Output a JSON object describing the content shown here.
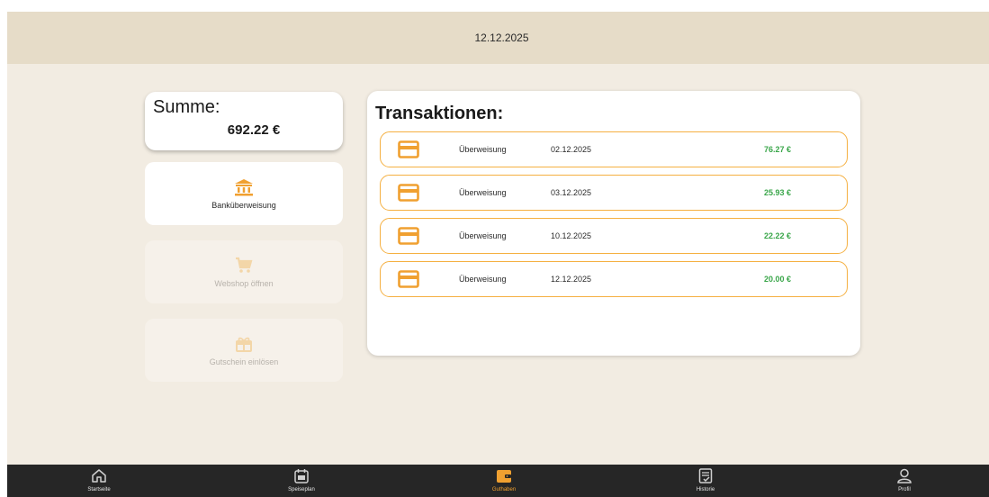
{
  "header": {
    "date": "12.12.2025"
  },
  "summary": {
    "label": "Summe:",
    "value": "692.22 €"
  },
  "actions": [
    {
      "label": "Banküberweisung",
      "icon": "bank-icon",
      "enabled": true
    },
    {
      "label": "Webshop öffnen",
      "icon": "cart-icon",
      "enabled": false
    },
    {
      "label": "Gutschein einlösen",
      "icon": "gift-icon",
      "enabled": false
    }
  ],
  "transactions": {
    "title": "Transaktionen:",
    "items": [
      {
        "type": "Überweisung",
        "date": "02.12.2025",
        "amount": "76.27 €"
      },
      {
        "type": "Überweisung",
        "date": "03.12.2025",
        "amount": "25.93 €"
      },
      {
        "type": "Überweisung",
        "date": "10.12.2025",
        "amount": "22.22 €"
      },
      {
        "type": "Überweisung",
        "date": "12.12.2025",
        "amount": "20.00 €"
      }
    ]
  },
  "nav": {
    "items": [
      {
        "label": "Startseite",
        "icon": "home-icon"
      },
      {
        "label": "Speiseplan",
        "icon": "calendar-icon"
      },
      {
        "label": "Guthaben",
        "icon": "wallet-icon",
        "active": true
      },
      {
        "label": "Historie",
        "icon": "history-icon"
      },
      {
        "label": "Profil",
        "icon": "profile-icon"
      }
    ]
  },
  "colors": {
    "accent": "#f0a030",
    "amount_positive": "#3aa64a",
    "header_bg": "#e6dcc8",
    "page_bg": "#f2ece2",
    "nav_bg": "#262626"
  }
}
